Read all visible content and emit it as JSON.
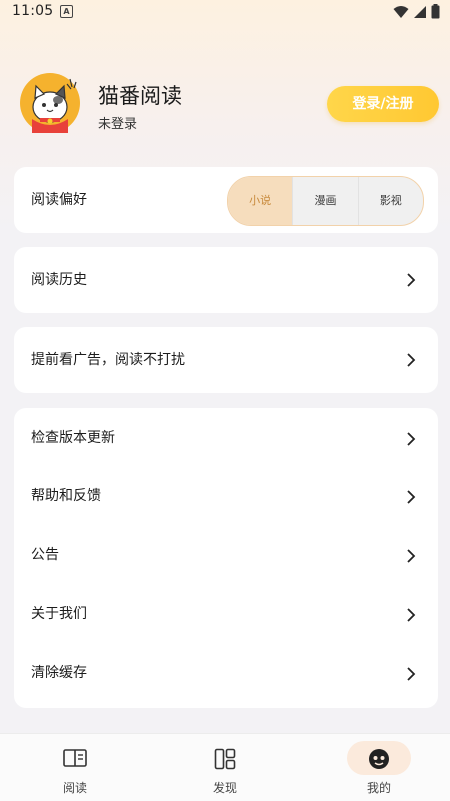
{
  "status_bar": {
    "time": "11:05",
    "notif_letter": "A"
  },
  "profile": {
    "app_name": "猫番阅读",
    "login_state": "未登录",
    "login_button": "登录/注册"
  },
  "reading_pref": {
    "label": "阅读偏好",
    "options": [
      "小说",
      "漫画",
      "影视"
    ],
    "selected": "小说"
  },
  "menu": {
    "history": "阅读历史",
    "ads": "提前看广告，阅读不打扰",
    "update": "检查版本更新",
    "help": "帮助和反馈",
    "notice": "公告",
    "about": "关于我们",
    "cache": "清除缓存"
  },
  "bottom_nav": {
    "read": "阅读",
    "discover": "发现",
    "mine": "我的",
    "active": "我的"
  },
  "colors": {
    "accent": "#ffcf3c",
    "selected_chip_bg": "#f6ddbd",
    "selected_chip_text": "#c88a3c"
  },
  "icons": [
    "wifi-icon",
    "signal-icon",
    "battery-icon",
    "chevron-right-icon",
    "book-icon",
    "grid-icon",
    "profile-face-icon"
  ]
}
